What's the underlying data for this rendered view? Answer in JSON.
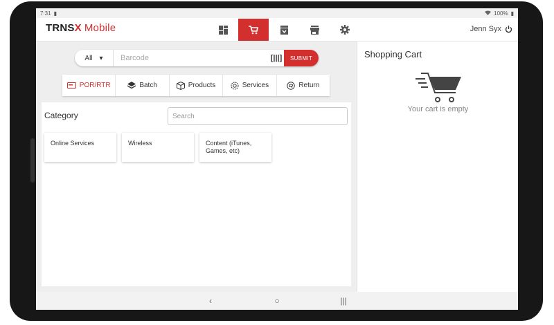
{
  "status": {
    "time": "7:31",
    "battery": "100%"
  },
  "app": {
    "brand_trns": "TRNS",
    "brand_x": "X",
    "brand_mobile": "Mobile"
  },
  "user": {
    "name": "Jenn Syx"
  },
  "search": {
    "filter_value": "All",
    "placeholder": "Barcode",
    "submit_label": "SUBMIT"
  },
  "tabs": [
    {
      "label": "POR/RTR",
      "icon": "pin-card-icon"
    },
    {
      "label": "Batch",
      "icon": "layers-icon"
    },
    {
      "label": "Products",
      "icon": "box-icon"
    },
    {
      "label": "Services",
      "icon": "gear-badge-icon"
    },
    {
      "label": "Return",
      "icon": "return-icon"
    }
  ],
  "category": {
    "title": "Category",
    "search_placeholder": "Search",
    "items": [
      "Online Services",
      "Wireless",
      "Content (iTunes, Games, etc)"
    ]
  },
  "cart": {
    "title": "Shopping Cart",
    "empty_text": "Your cart is empty"
  },
  "colors": {
    "accent": "#d32f2f",
    "panel_bg": "#eeeeee"
  }
}
